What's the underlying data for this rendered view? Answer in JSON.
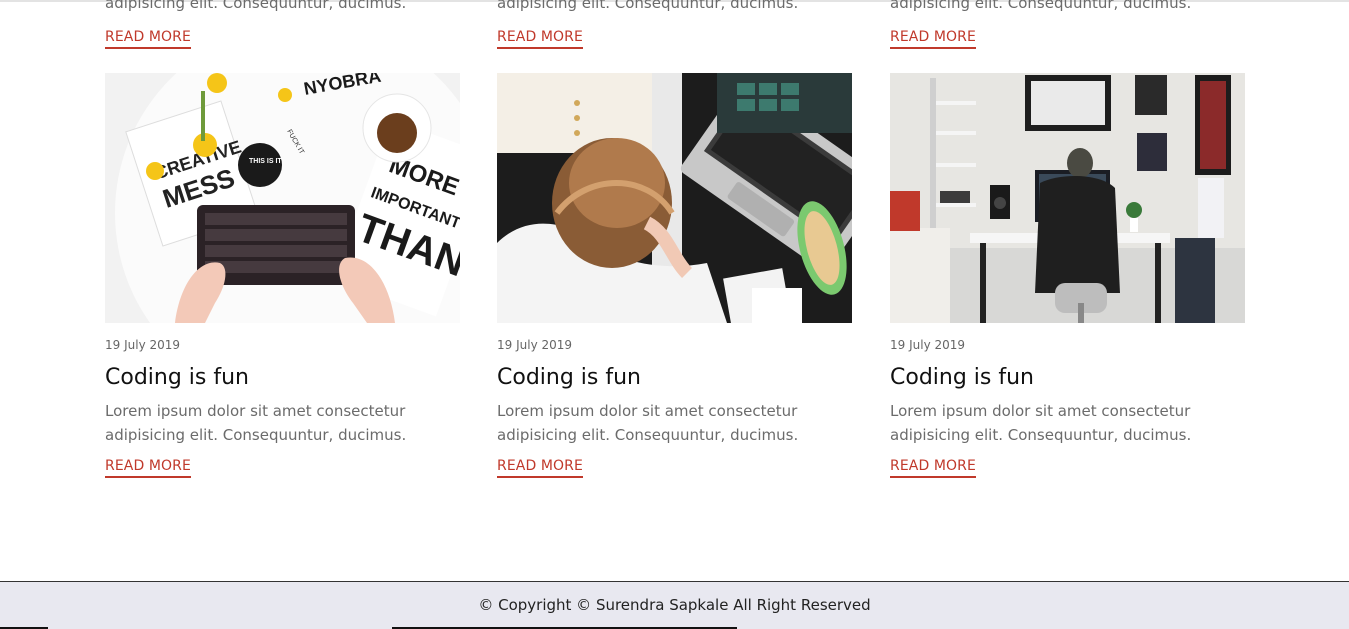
{
  "previous_cards": [
    {
      "excerpt_tail": "adipisicing elit. Consequuntur, ducimus.",
      "read_more": "READ MORE"
    },
    {
      "excerpt_tail": "adipisicing elit. Consequuntur, ducimus.",
      "read_more": "READ MORE"
    },
    {
      "excerpt_tail": "adipisicing elit. Consequuntur, ducimus.",
      "read_more": "READ MORE"
    }
  ],
  "cards": [
    {
      "date": "19 July 2019",
      "title": "Coding is fun",
      "excerpt_line1": "Lorem ipsum dolor sit amet consectetur",
      "excerpt_line2": "adipisicing elit. Consequuntur, ducimus.",
      "read_more": "READ MORE",
      "image": {
        "label_lines": [
          "CREATIVE",
          "MESS",
          "THIS IS IT",
          "MORE",
          "IMPORTANT",
          "THAN",
          "NYOBRA",
          "FUCK IT"
        ]
      }
    },
    {
      "date": "19 July 2019",
      "title": "Coding is fun",
      "excerpt_line1": "Lorem ipsum dolor sit amet consectetur",
      "excerpt_line2": "adipisicing elit. Consequuntur, ducimus.",
      "read_more": "READ MORE"
    },
    {
      "date": "19 July 2019",
      "title": "Coding is fun",
      "excerpt_line1": "Lorem ipsum dolor sit amet consectetur",
      "excerpt_line2": "adipisicing elit. Consequuntur, ducimus.",
      "read_more": "READ MORE"
    }
  ],
  "footer": {
    "text": "© Copyright © Surendra Sapkale All Right Reserved"
  },
  "colors": {
    "accent": "#c0392b",
    "footer_bg": "#e8e8f0",
    "text_muted": "#6b6b6b",
    "title": "#111111"
  }
}
